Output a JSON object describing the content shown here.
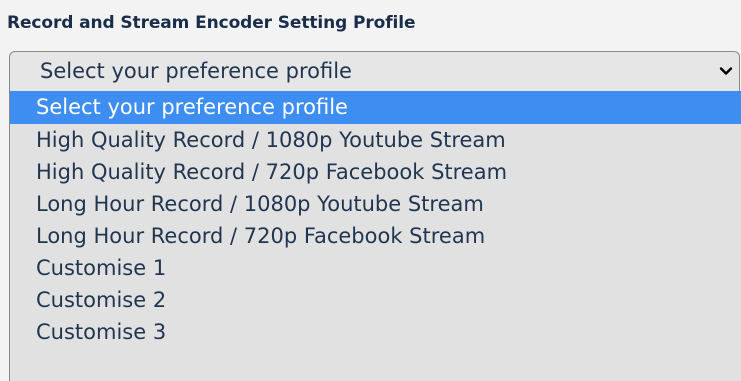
{
  "section": {
    "title": "Record and Stream Encoder Setting Profile"
  },
  "select": {
    "value": "Select your preference profile",
    "icon": "chevron-down-icon"
  },
  "dropdown": {
    "options": [
      {
        "label": "Select your preference profile",
        "selected": true
      },
      {
        "label": "High Quality Record / 1080p Youtube Stream",
        "selected": false
      },
      {
        "label": "High Quality Record / 720p Facebook Stream",
        "selected": false
      },
      {
        "label": "Long Hour Record / 1080p Youtube Stream",
        "selected": false
      },
      {
        "label": "Long Hour Record / 720p Facebook Stream",
        "selected": false
      },
      {
        "label": "Customise 1",
        "selected": false
      },
      {
        "label": "Customise 2",
        "selected": false
      },
      {
        "label": "Customise 3",
        "selected": false
      }
    ],
    "highlight_color": "#3d8ef0"
  }
}
